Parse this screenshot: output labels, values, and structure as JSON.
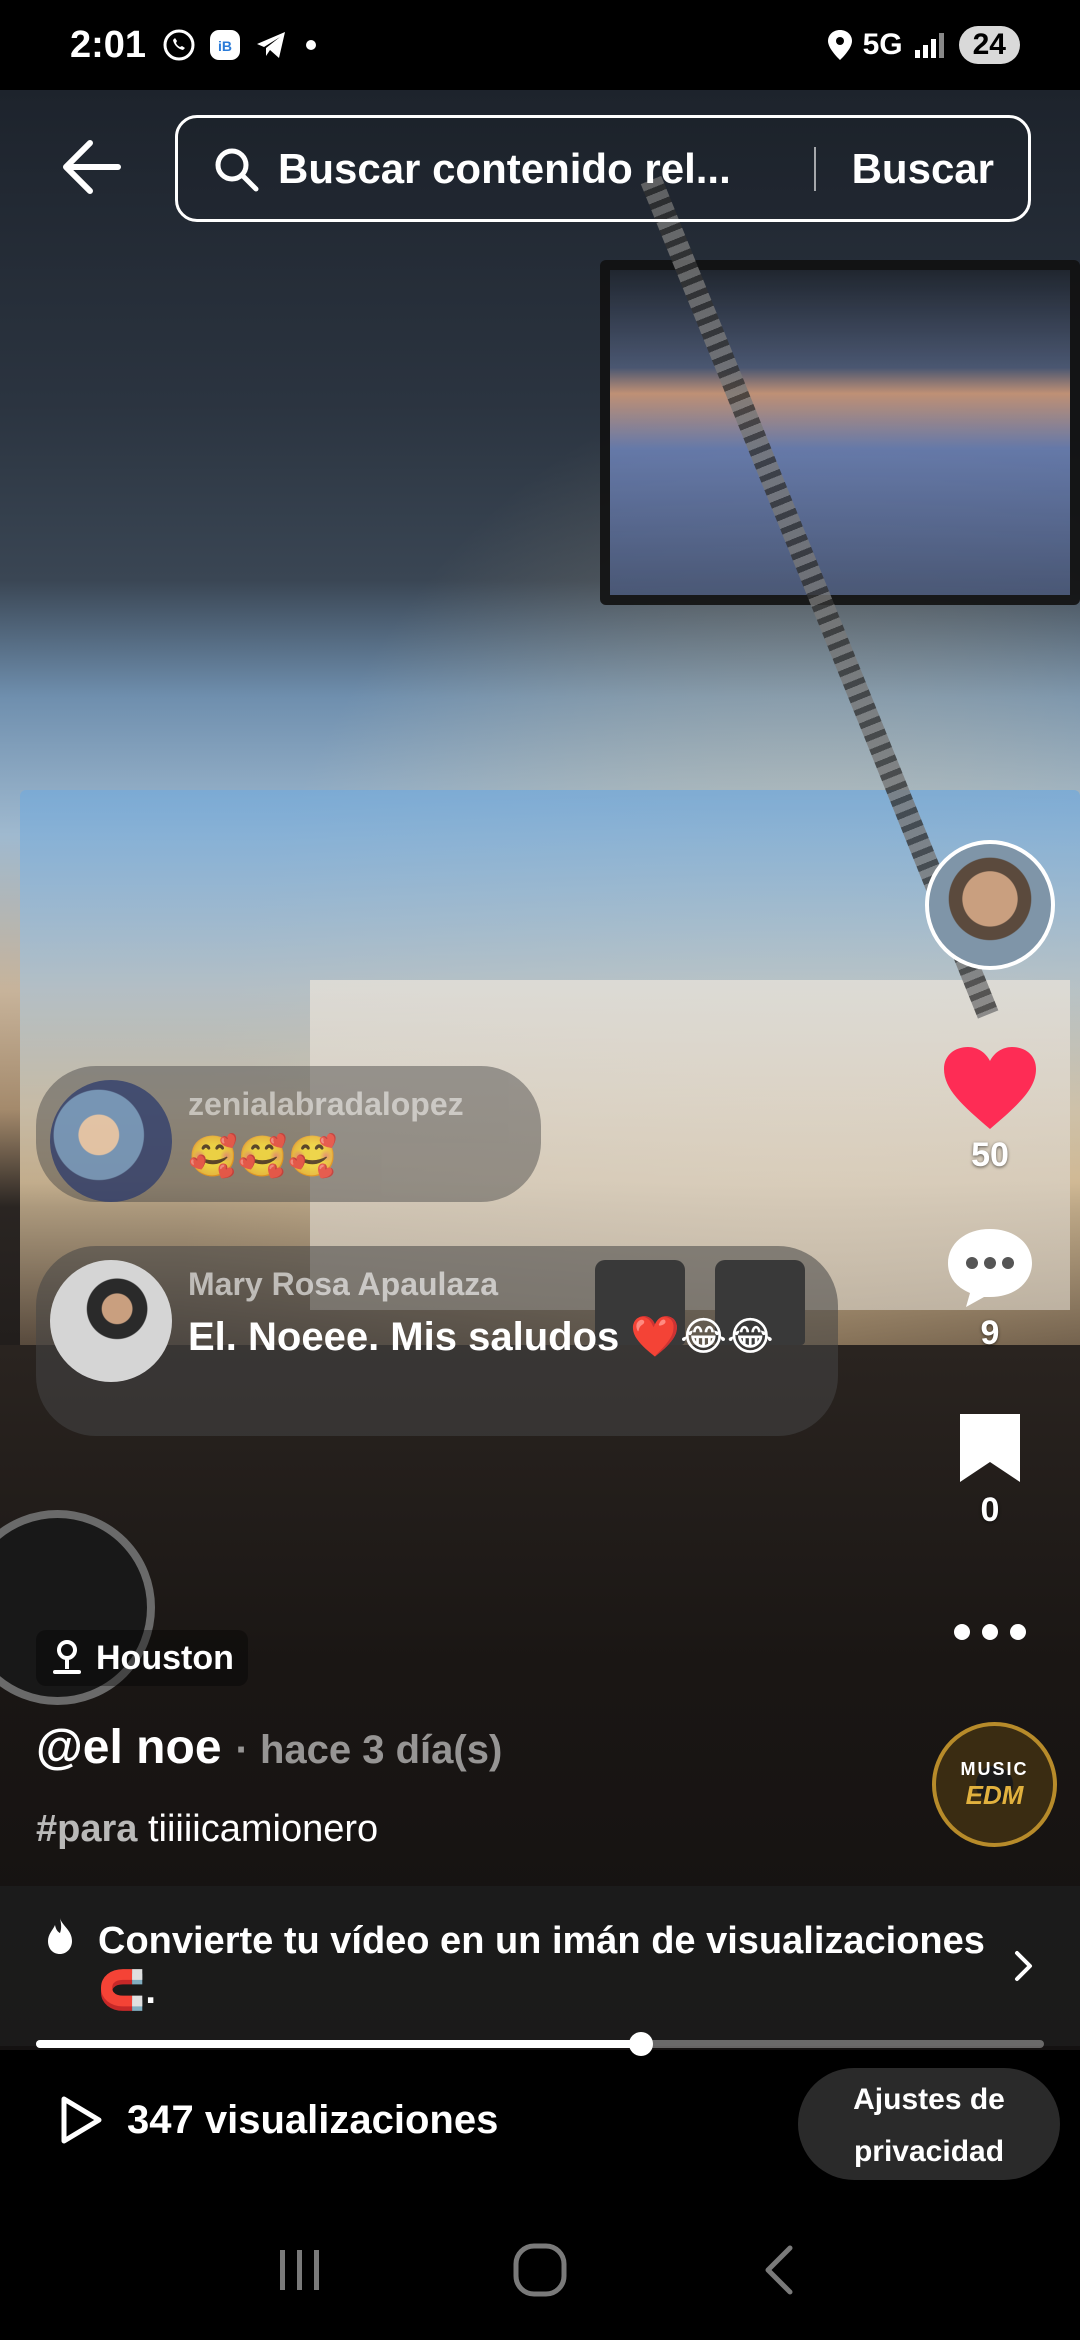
{
  "status_bar": {
    "time": "2:01",
    "network": "5G",
    "battery": "24",
    "icons": [
      "whatsapp-icon",
      "app-badge-icon",
      "telegram-icon",
      "location-icon",
      "signal-icon"
    ]
  },
  "search": {
    "placeholder": "Buscar contenido rel...",
    "button_label": "Buscar"
  },
  "side_rail": {
    "likes": "50",
    "comments": "9",
    "saves": "0",
    "music_label_top": "MUSIC",
    "music_label_bottom": "EDM",
    "like_color": "#fe2c55"
  },
  "comments": [
    {
      "user": "zenialabradalopez",
      "text": "🥰🥰🥰"
    },
    {
      "user": "Mary Rosa Apaulaza",
      "text": "El. Noeee. Mis saludos ❤️😂😂"
    }
  ],
  "post": {
    "location": "Houston",
    "author": "@el noe",
    "time": "· hace 3 día(s)",
    "hashtag": "#para",
    "caption_rest": " tiiiiicamionero"
  },
  "promo": {
    "text": "Convierte tu vídeo en un imán de visualizaciones 🧲."
  },
  "playback": {
    "progress": 0.6
  },
  "footer": {
    "views": "347 visualizaciones",
    "privacy_label": "Ajustes de privacidad"
  }
}
